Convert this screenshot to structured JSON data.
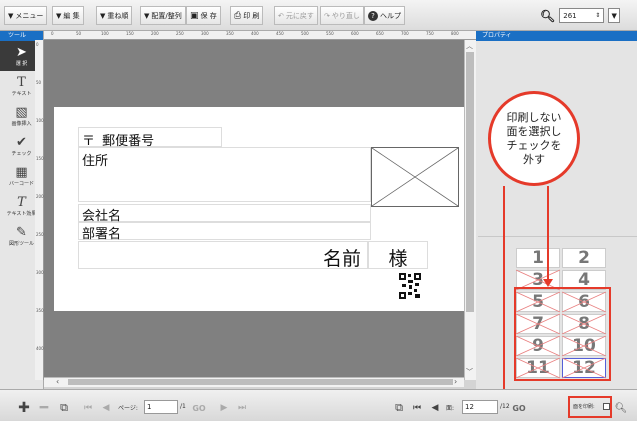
{
  "toolbar": {
    "menu": "メニュー",
    "edit": "編 集",
    "stack": "重ね順",
    "align": "配置/整列",
    "save": "保 存",
    "print": "印 刷",
    "undo": "元に戻す",
    "redo": "やり直し",
    "help": "ヘルプ",
    "zoom_value": "261"
  },
  "tools": {
    "title": "ツール",
    "items": [
      {
        "label": "選 択",
        "icon": "cursor-icon"
      },
      {
        "label": "テキスト",
        "icon": "text-icon"
      },
      {
        "label": "画像挿入",
        "icon": "image-icon"
      },
      {
        "label": "チェック",
        "icon": "check-icon"
      },
      {
        "label": "バーコード",
        "icon": "barcode-icon"
      },
      {
        "label": "テキスト効果",
        "icon": "text-effect-icon"
      },
      {
        "label": "図形ツール",
        "icon": "shape-icon"
      }
    ]
  },
  "ruler": {
    "top": [
      "0",
      "50",
      "100",
      "150",
      "200",
      "250",
      "300",
      "350",
      "400",
      "450",
      "500",
      "550",
      "600",
      "650",
      "700",
      "750",
      "800"
    ],
    "left": [
      "0",
      "50",
      "100",
      "150",
      "200",
      "250",
      "300",
      "350",
      "400"
    ]
  },
  "card": {
    "postal_mark": "〒",
    "postal_label": "郵便番号",
    "address": "住所",
    "company": "会社名",
    "department": "部署名",
    "name": "名前",
    "honorific": "様"
  },
  "properties": {
    "title": "プロパティ"
  },
  "callout": {
    "lines": [
      "印刷しない",
      "面を選択し",
      "チェックを",
      "外す"
    ],
    "color": "#e53a2a"
  },
  "faces": [
    "1",
    "2",
    "3",
    "4",
    "5",
    "6",
    "7",
    "8",
    "9",
    "10",
    "11",
    "12"
  ],
  "bottombar": {
    "page_label": "ページ:",
    "page_value": "1",
    "page_total": "/1",
    "go": "GO",
    "face_label": "面:",
    "face_value": "12",
    "face_total": "/12",
    "face_go": "GO",
    "print_face_label": "面を印刷:"
  }
}
